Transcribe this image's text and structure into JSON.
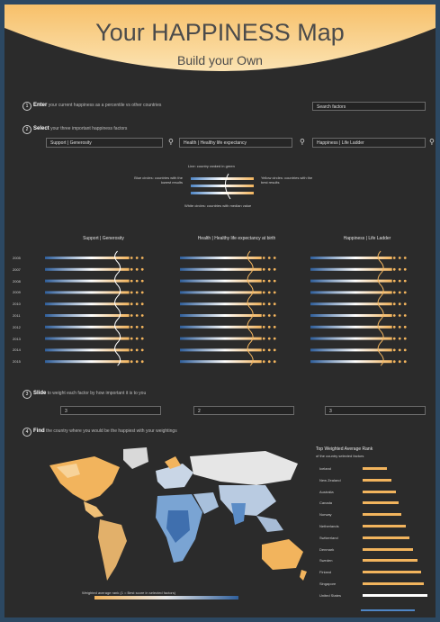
{
  "header": {
    "title": "Your HAPPINESS Map",
    "subtitle": "Build your Own"
  },
  "steps": [
    {
      "num": "1",
      "verb": "Enter",
      "text": "your current happiness as a percentile vs other countries"
    },
    {
      "num": "2",
      "verb": "Select",
      "text": "your three important happiness factors"
    },
    {
      "num": "3",
      "verb": "Slide",
      "text": "to weight each factor by how important it is to you"
    },
    {
      "num": "4",
      "verb": "Find",
      "text": "the country where you would be the happiest with your weightings"
    }
  ],
  "search": {
    "placeholder": "Search factors"
  },
  "factors": [
    "Support | Generosity",
    "Health | Healthy life expectancy",
    "Happiness | Life Ladder"
  ],
  "legend": {
    "header": "Line: country ranked in green",
    "left": "Blue circles: countries with the lowest results",
    "right": "Yellow circles: countries with the best results",
    "bottom": "White circles: countries with median value"
  },
  "columns": [
    "Support | Generosity",
    "Health | Healthy life expectancy at birth",
    "Happiness | Life Ladder"
  ],
  "years": [
    "2005",
    "2007",
    "2008",
    "2009",
    "2010",
    "2011",
    "2012",
    "2013",
    "2014",
    "2015"
  ],
  "weights": [
    "3",
    "2",
    "3"
  ],
  "ranking": {
    "title": "Top Weighted Average Rank",
    "subtitle": "of the country selected factors",
    "items": [
      {
        "name": "Iceland",
        "value": 0.38
      },
      {
        "name": "New Zealand",
        "value": 0.45
      },
      {
        "name": "Australia",
        "value": 0.52
      },
      {
        "name": "Canada",
        "value": 0.55
      },
      {
        "name": "Norway",
        "value": 0.6
      },
      {
        "name": "Netherlands",
        "value": 0.66
      },
      {
        "name": "Switzerland",
        "value": 0.72
      },
      {
        "name": "Denmark",
        "value": 0.78
      },
      {
        "name": "Sweden",
        "value": 0.85
      },
      {
        "name": "Finland",
        "value": 0.9
      },
      {
        "name": "Singapore",
        "value": 0.95
      },
      {
        "name": "United States",
        "value": 1.0
      }
    ]
  },
  "colorbar": {
    "caption": "Weighted average rank (1 = Best score in selected factors)"
  },
  "colors": {
    "accent": "#f2b45d",
    "blue": "#4f86c6",
    "bg": "#2b2b2b"
  }
}
